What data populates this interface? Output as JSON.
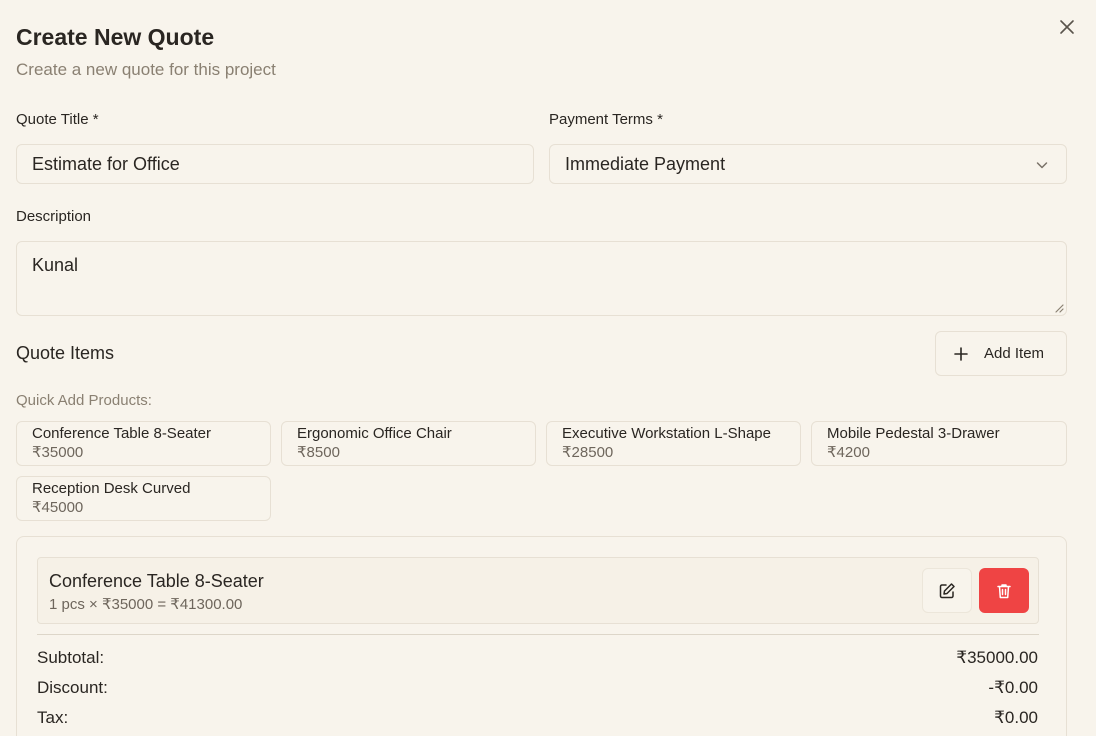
{
  "dialog": {
    "title": "Create New Quote",
    "subtitle": "Create a new quote for this project",
    "close_icon": "close-icon"
  },
  "form": {
    "quote_title_label": "Quote Title *",
    "quote_title_value": "Estimate for Office",
    "payment_terms_label": "Payment Terms *",
    "payment_terms_value": "Immediate Payment",
    "description_label": "Description",
    "description_value": "Kunal"
  },
  "quote_items": {
    "title": "Quote Items",
    "add_item_label": "Add Item",
    "quick_add_label": "Quick Add Products:",
    "products": [
      {
        "name": "Conference Table 8-Seater",
        "price": "₹35000"
      },
      {
        "name": "Ergonomic Office Chair",
        "price": "₹8500"
      },
      {
        "name": "Executive Workstation L-Shape",
        "price": "₹28500"
      },
      {
        "name": "Mobile Pedestal 3-Drawer",
        "price": "₹4200"
      },
      {
        "name": "Reception Desk Curved",
        "price": "₹45000"
      }
    ],
    "items": [
      {
        "name": "Conference Table 8-Seater",
        "detail": "1 pcs × ₹35000 = ₹41300.00"
      }
    ]
  },
  "summary": {
    "subtotal_label": "Subtotal:",
    "subtotal_value": "₹35000.00",
    "discount_label": "Discount:",
    "discount_value": "-₹0.00",
    "tax_label": "Tax:",
    "tax_value": "₹0.00"
  },
  "colors": {
    "background": "#f8f4ec",
    "delete_button": "#ef4444",
    "muted_text": "#8a8072"
  }
}
